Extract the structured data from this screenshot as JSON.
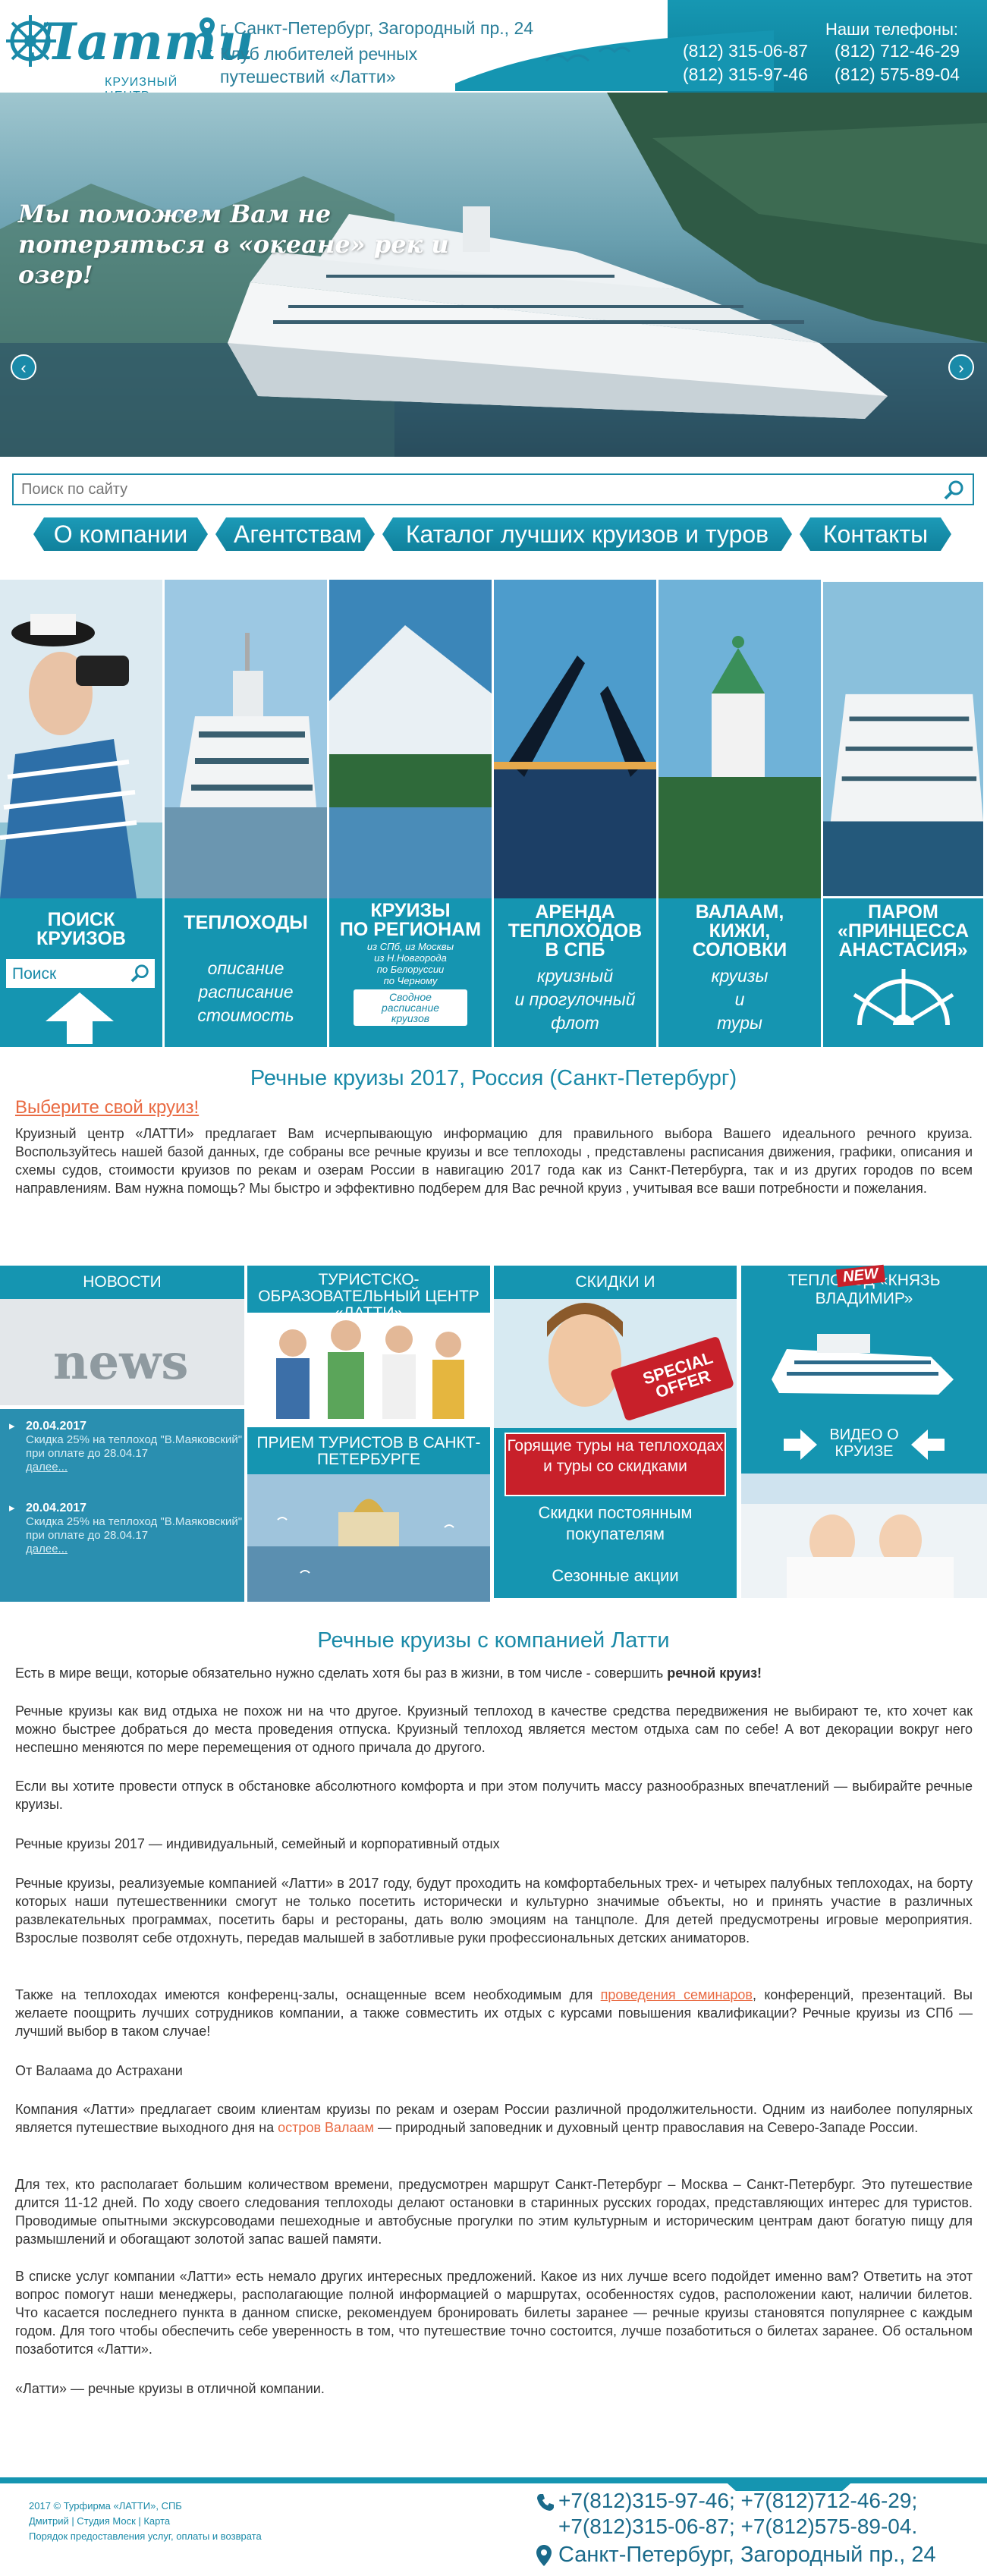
{
  "header": {
    "logo_text": "Латти",
    "logo_sub": "КРУИЗНЫЙ ЦЕНТР",
    "address": "г. Санкт-Петербург, Загородный пр., 24",
    "club": "Клуб любителей речных путешествий «Латти»",
    "phones_title": "Наши телефоны:",
    "phones": [
      "(812) 315-06-87",
      "(812) 712-46-29",
      "(812) 315-97-46",
      "(812) 575-89-04"
    ]
  },
  "hero": {
    "slogan": "Мы поможем Вам не потеряться в «океане» рек и озер!",
    "prev_icon": "chevron-left-icon",
    "next_icon": "chevron-right-icon",
    "active_slide": 1,
    "slides_count": 5
  },
  "search": {
    "placeholder": "Поиск по сайту"
  },
  "nav": [
    {
      "label": "О компании"
    },
    {
      "label": "Агентствам"
    },
    {
      "label": "Каталог лучших круизов и туров"
    },
    {
      "label": "Контакты"
    }
  ],
  "tiles": [
    {
      "title": "ПОИСК\nКРУИЗОВ",
      "search_placeholder": "Поиск"
    },
    {
      "title": "ТЕПЛОХОДЫ",
      "sub": "описание\nрасписание\nстоимость"
    },
    {
      "title": "КРУИЗЫ\nПО РЕГИОНАМ",
      "sub": "из СПб, из Москвы\nиз Н.Новгорода\nпо Белоруссии\nпо Черному",
      "button": "Сводное расписание круизов"
    },
    {
      "title": "АРЕНДА\nТЕПЛОХОДОВ\nВ СПБ",
      "sub": "круизный\nи прогулочный\nфлот"
    },
    {
      "title": "ВАЛААМ,\nКИЖИ,\nСОЛОВКИ",
      "sub": "круизы\nи\nтуры"
    },
    {
      "title": "ПАРОМ\n«ПРИНЦЕССА\nАНАСТАСИЯ»"
    }
  ],
  "section1": {
    "title": "Речные круизы 2017, Россия (Санкт-Петербург)",
    "link": "Выберите свой круиз!",
    "text": "Круизный центр «ЛАТТИ» предлагает Вам исчерпывающую информацию для правильного выбора Вашего идеального речного круиза. Воспользуйтесь нашей базой данных, где собраны все речные круизы и все теплоходы , представлены расписания движения, графики, описания и схемы судов, стоимости круизов по рекам и озерам России в навигацию 2017 года как из Санкт-Петербурга, так и из других городов по всем направлениям. Вам нужна помощь? Мы быстро и эффективно подберем для Вас речной круиз , учитывая все ваши потребности и пожелания."
  },
  "promo": {
    "news": {
      "header": "НОВОСТИ",
      "items": [
        {
          "date": "20.04.2017",
          "text": "Скидка 25% на теплоход \"В.Маяковский\" при оплате до 28.04.17",
          "more": "далее..."
        },
        {
          "date": "20.04.2017",
          "text": "Скидка 25% на теплоход \"В.Маяковский\" при оплате до 28.04.17",
          "more": "далее..."
        }
      ]
    },
    "edu": {
      "header": "ТУРИСТСКО-ОБРАЗОВАТЕЛЬНЫЙ ЦЕНТР «ЛАТТИ»"
    },
    "reception": {
      "header": "ПРИЕМ ТУРИСТОВ В САНКТ-ПЕТЕРБУРГЕ"
    },
    "discounts": {
      "header": "СКИДКИ И СПЕЦПРЕДЛОЖЕНИЯ",
      "tag": "SPECIAL OFFER",
      "hot": "Горящие туры на теплоходах и туры со скидками",
      "items": [
        "Скидки постоянным покупателям",
        "Сезонные акции"
      ]
    },
    "ship": {
      "header": "ТЕПЛОХОД «КНЯЗЬ ВЛАДИМИР»",
      "badge": "NEW"
    },
    "video": {
      "header": "ВИДЕО О КРУИЗЕ"
    }
  },
  "section2": {
    "title": "Речные круизы с компанией Латти",
    "p1": "Есть в мире вещи, которые обязательно нужно сделать хотя бы раз в жизни, в том числе - совершить ",
    "p1_bold": "речной круиз!",
    "p2": "Речные круизы как вид отдыха не похож ни на что другое. Круизный теплоход в качестве средства передвижения не выбирают те, кто хочет как можно быстрее добраться до места проведения отпуска. Круизный теплоход является местом отдыха сам по себе! А вот декорации вокруг него неспешно меняются по мере перемещения от одного причала до другого.",
    "p3": "Если вы хотите провести отпуск в обстановке абсолютного комфорта и при этом получить массу разнообразных впечатлений — выбирайте речные круизы.",
    "p4": "Речные круизы 2017 — индивидуальный, семейный и корпоративный отдых",
    "p5": "Речные круизы, реализуемые компанией «Латти» в 2017 году, будут проходить на комфортабельных трех- и четырех палубных теплоходах, на борту которых наши путешественники смогут не только посетить исторически и культурно значимые объекты, но и принять участие в различных развлекательных программах, посетить бары и рестораны, дать волю эмоциям на танцполе. Для детей предусмотрены игровые мероприятия. Взрослые позволят себе отдохнуть, передав малышей в заботливые руки профессиональных детских аниматоров.",
    "p6a": "Также на теплоходах имеются конференц-залы, оснащенные всем необходимым для ",
    "p6_link": "проведения семинаров",
    "p6b": ", конференций, презентаций. Вы желаете поощрить лучших сотрудников компании, а также совместить их отдых с курсами повышения квалификации? Речные круизы из СПб — лучший выбор в таком случае!",
    "p7": "От Валаама до Астрахани",
    "p8a": "Компания «Латти» предлагает своим клиентам круизы по рекам и озерам России различной продолжительности. Одним из наиболее популярных является путешествие выходного дня на ",
    "p8_link": "остров Валаам",
    "p8b": " — природный заповедник и духовный центр православия на Северо-Западе России.",
    "p9": "Для тех, кто располагает большим количеством времени, предусмотрен маршрут Санкт-Петербург – Москва – Санкт-Петербург. Это путешествие длится 11-12 дней. По ходу своего следования теплоходы делают остановки в старинных русских городах, представляющих интерес для туристов. Проводимые опытными экскурсоводами пешеходные и автобусные прогулки по этим культурным и историческим центрам дают богатую пищу для размышлений и обогащают золотой запас вашей памяти.",
    "p10": "В списке услуг компании «Латти» есть немало других интересных предложений. Какое из них лучше всего подойдет именно вам? Ответить на этот вопрос помогут наши менеджеры, располагающие полной информацией о маршрутах, особенностях судов, расположении кают, наличии билетов. Что касается последнего пункта в данном списке, рекомендуем бронировать билеты заранее — речные круизы становятся популярнее с каждым годом. Для того чтобы обеспечить себе уверенность в том, что путешествие точно состоится, лучше позаботиться о билетах заранее. Об остальном позаботится «Латти».",
    "p11": "«Латти» — речные круизы в отличной компании."
  },
  "footer": {
    "copy1": "2017 © Турфирма «ЛАТТИ», СПБ",
    "copy2": "Дмитрий | Студия Моск | Карта",
    "copy3": "Порядок предоставления услуг, оплаты и возврата",
    "phones": "+7(812)315-97-46;  +7(812)712-46-29;\n+7(812)315-06-87;  +7(812)575-89-04.",
    "address": "Санкт-Петербург, Загородный пр., 24"
  },
  "colors": {
    "accent": "#1595b1",
    "link": "#e96a42",
    "dark": "#1a6a8a"
  }
}
